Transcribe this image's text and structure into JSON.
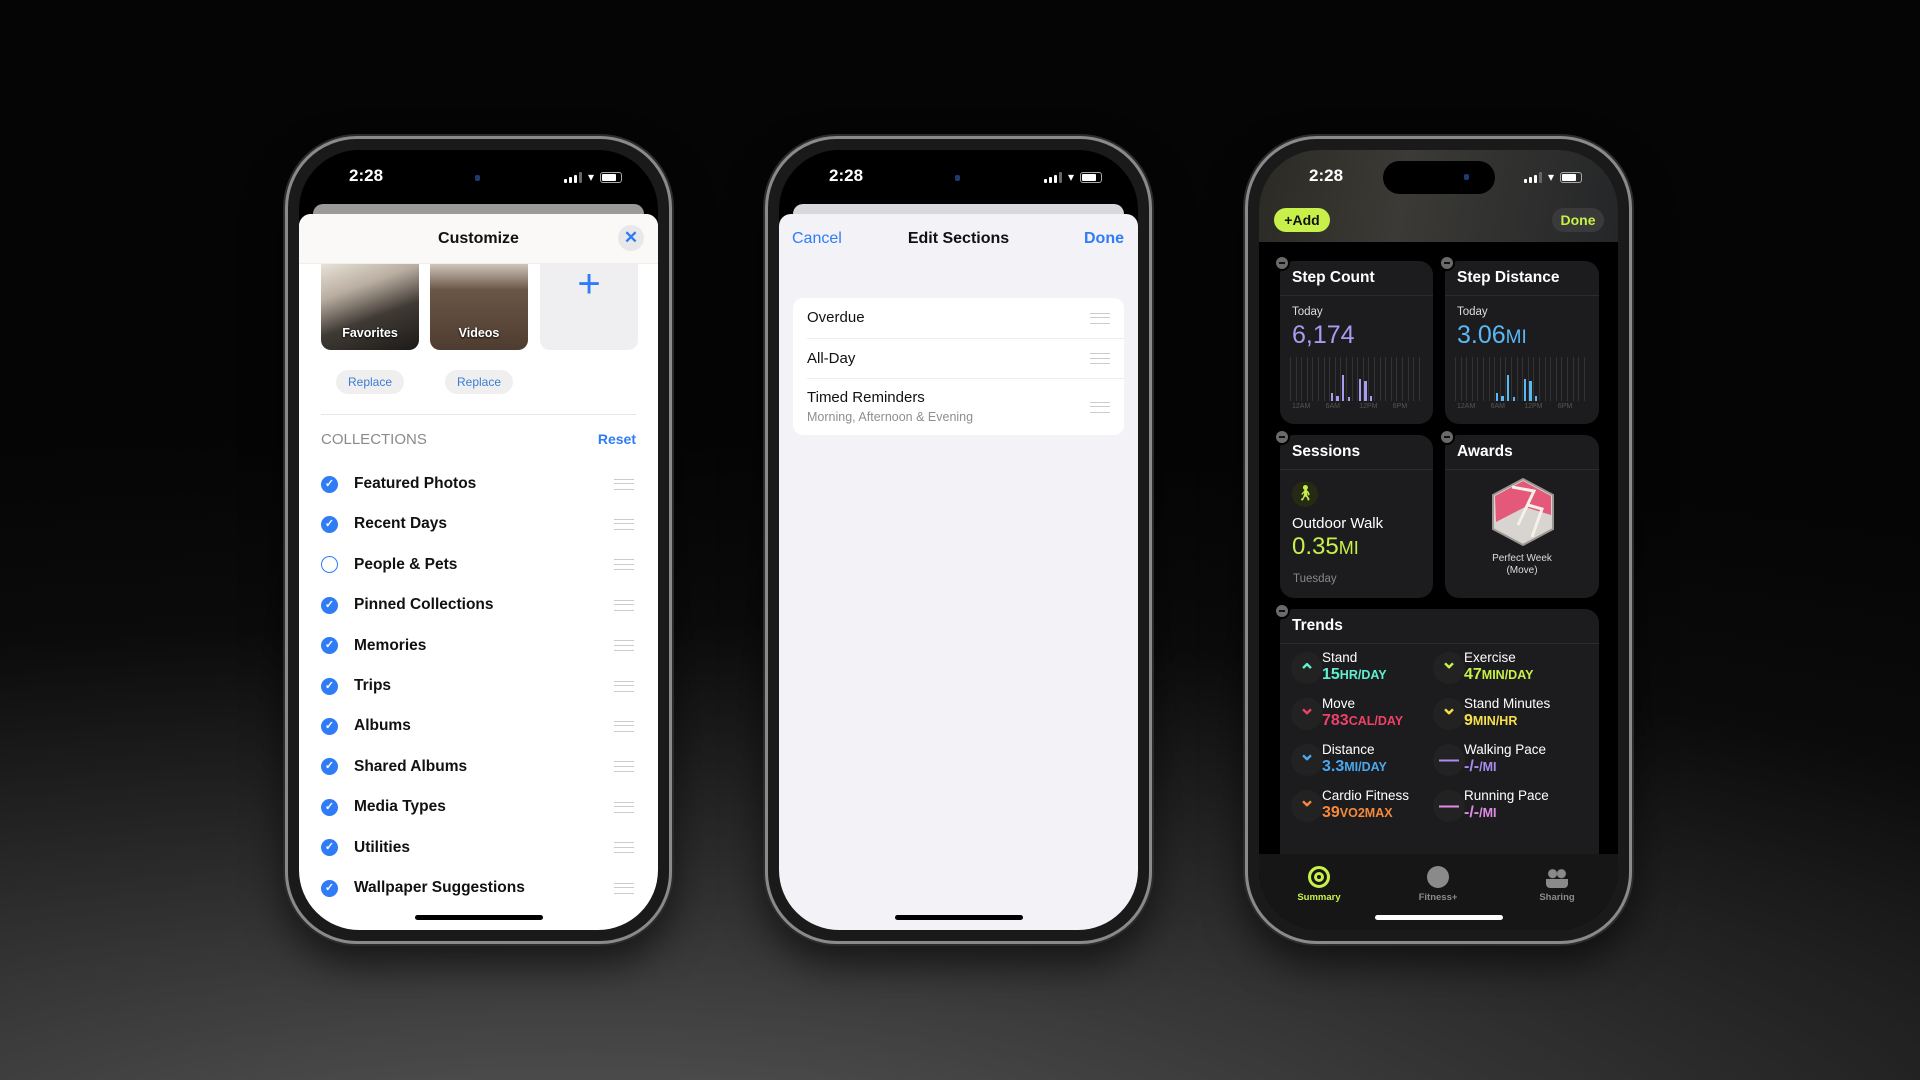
{
  "status": {
    "time": "2:28"
  },
  "photos": {
    "title": "Customize",
    "close_icon": "close-icon",
    "thumbs": [
      {
        "label": "Favorites",
        "button": "Replace"
      },
      {
        "label": "Videos",
        "button": "Replace"
      }
    ],
    "add_icon": "plus-icon",
    "section_header": "COLLECTIONS",
    "reset": "Reset",
    "collections": [
      {
        "label": "Featured Photos",
        "checked": true
      },
      {
        "label": "Recent Days",
        "checked": true
      },
      {
        "label": "People & Pets",
        "checked": false
      },
      {
        "label": "Pinned Collections",
        "checked": true
      },
      {
        "label": "Memories",
        "checked": true
      },
      {
        "label": "Trips",
        "checked": true
      },
      {
        "label": "Albums",
        "checked": true
      },
      {
        "label": "Shared Albums",
        "checked": true
      },
      {
        "label": "Media Types",
        "checked": true
      },
      {
        "label": "Utilities",
        "checked": true
      },
      {
        "label": "Wallpaper Suggestions",
        "checked": true
      }
    ]
  },
  "reminders": {
    "cancel": "Cancel",
    "title": "Edit Sections",
    "done": "Done",
    "sections": [
      {
        "label": "Overdue",
        "sub": ""
      },
      {
        "label": "All-Day",
        "sub": ""
      },
      {
        "label": "Timed Reminders",
        "sub": "Morning, Afternoon & Evening"
      }
    ]
  },
  "fitness": {
    "add": "+Add",
    "done": "Done",
    "step_count": {
      "title": "Step Count",
      "period": "Today",
      "value": "6,174",
      "color": "#a79cf0",
      "ticks": [
        "12AM",
        "6AM",
        "12PM",
        "6PM"
      ]
    },
    "step_distance": {
      "title": "Step Distance",
      "period": "Today",
      "value": "3.06",
      "unit": "MI",
      "color": "#5ab8f5",
      "ticks": [
        "12AM",
        "6AM",
        "12PM",
        "6PM"
      ]
    },
    "sessions": {
      "title": "Sessions",
      "name": "Outdoor Walk",
      "value": "0.35",
      "unit": "MI",
      "day": "Tuesday",
      "color": "#c8f04a"
    },
    "awards": {
      "title": "Awards",
      "name": "Perfect Week",
      "sub": "(Move)"
    },
    "trends": {
      "title": "Trends",
      "items": [
        {
          "name": "Stand",
          "value": "15",
          "unit": "HR/DAY",
          "dir": "up",
          "color": "#5ef0d0"
        },
        {
          "name": "Exercise",
          "value": "47",
          "unit": "MIN/DAY",
          "dir": "down",
          "color": "#c8f04a"
        },
        {
          "name": "Move",
          "value": "783",
          "unit": "CAL/DAY",
          "dir": "down",
          "color": "#f0406a"
        },
        {
          "name": "Stand Minutes",
          "value": "9",
          "unit": "MIN/HR",
          "dir": "down",
          "color": "#f5e04a"
        },
        {
          "name": "Distance",
          "value": "3.3",
          "unit": "MI/DAY",
          "dir": "down",
          "color": "#4aa8f0"
        },
        {
          "name": "Walking Pace",
          "value": "-/-",
          "unit": "/MI",
          "dir": "flat",
          "color": "#a88cf0"
        },
        {
          "name": "Cardio Fitness",
          "value": "39",
          "unit": "VO2MAX",
          "dir": "down",
          "color": "#f58a3c"
        },
        {
          "name": "Running Pace",
          "value": "-/-",
          "unit": "/MI",
          "dir": "flat",
          "color": "#e08ce8"
        }
      ]
    },
    "tabs": [
      {
        "label": "Summary",
        "active": true
      },
      {
        "label": "Fitness+",
        "active": false
      },
      {
        "label": "Sharing",
        "active": false
      }
    ]
  }
}
